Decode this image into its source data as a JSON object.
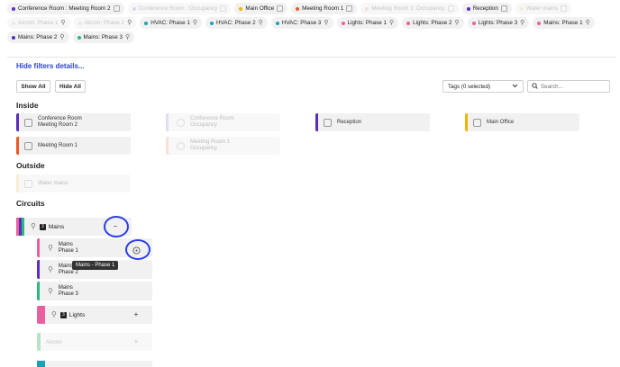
{
  "chips": [
    {
      "label": "Conference Room : Meeting Room 2",
      "color": "#5b2dbd",
      "faded": false,
      "icon": "square"
    },
    {
      "label": "Conference Room : Occupancy",
      "color": "#b9a6e6",
      "faded": true,
      "icon": "square"
    },
    {
      "label": "Main Office",
      "color": "#f0b400",
      "faded": false,
      "icon": "square"
    },
    {
      "label": "Meeting Room 1",
      "color": "#ee5a24",
      "faded": false,
      "icon": "square"
    },
    {
      "label": "Meeting Room 1: Occupancy",
      "color": "#f6b89f",
      "faded": true,
      "icon": "square"
    },
    {
      "label": "Reception",
      "color": "#5b2dbd",
      "faded": false,
      "icon": "square"
    },
    {
      "label": "Water mains",
      "color": "#f8d98b",
      "faded": true,
      "icon": "square"
    },
    {
      "label": "Aircon: Phase 1",
      "color": "#b7e4c7",
      "faded": true,
      "icon": "bulb"
    },
    {
      "label": "Aircon: Phase 2",
      "color": "#b7e4c7",
      "faded": true,
      "icon": "bulb"
    },
    {
      "label": "HVAC: Phase 1",
      "color": "#1aa3b8",
      "faded": false,
      "icon": "bulb"
    },
    {
      "label": "HVAC: Phase 2",
      "color": "#1aa3b8",
      "faded": false,
      "icon": "bulb"
    },
    {
      "label": "HVAC: Phase 3",
      "color": "#1aa3b8",
      "faded": false,
      "icon": "bulb"
    },
    {
      "label": "Lights: Phase 1",
      "color": "#ea5f9e",
      "faded": false,
      "icon": "bulb"
    },
    {
      "label": "Lights: Phase 2",
      "color": "#ea5f9e",
      "faded": false,
      "icon": "bulb"
    },
    {
      "label": "Lights: Phase 3",
      "color": "#ea5f9e",
      "faded": false,
      "icon": "bulb"
    },
    {
      "label": "Mains: Phase 1",
      "color": "#ea5f9e",
      "faded": false,
      "icon": "bulb"
    },
    {
      "label": "Mains: Phase 2",
      "color": "#5b2dbd",
      "faded": false,
      "icon": "bulb"
    },
    {
      "label": "Mains: Phase 3",
      "color": "#2ab880",
      "faded": false,
      "icon": "bulb"
    }
  ],
  "filters": {
    "hide_link": "Hide filters details...",
    "show_all": "Show All",
    "hide_all": "Hide All",
    "tags_select": "Tags (0 selected)",
    "search_placeholder": "Search..."
  },
  "sections": {
    "inside": "Inside",
    "outside": "Outside",
    "circuits": "Circuits"
  },
  "inside_cards": [
    {
      "line1": "Conference Room",
      "line2": "Meeting Room 2",
      "color": "#5b2dbd",
      "faded": false
    },
    {
      "line1": "Conference Room",
      "line2": "Occupancy",
      "color": "#b9a6e6",
      "faded": true
    },
    {
      "line1": "Reception",
      "line2": "",
      "color": "#5b2dbd",
      "faded": false
    },
    {
      "line1": "Main Office",
      "line2": "",
      "color": "#f0b400",
      "faded": false
    },
    {
      "line1": "Meeting Room 1",
      "line2": "",
      "color": "#ee5a24",
      "faded": false
    },
    {
      "line1": "Meeting Room 1",
      "line2": "Occupancy",
      "color": "#f6b89f",
      "faded": true
    }
  ],
  "outside_cards": [
    {
      "line1": "Water mains",
      "line2": "",
      "color": "#f8d98b",
      "faded": true
    }
  ],
  "circuits": {
    "mains": {
      "label": "Mains",
      "count": "3",
      "toggle": "−",
      "colors": [
        "#ea5f9e",
        "#5b2dbd",
        "#2ab880"
      ]
    },
    "phases": [
      {
        "line1": "Mains",
        "line2": "Phase 1",
        "color": "#ea5f9e"
      },
      {
        "line1": "Mains",
        "line2": "Phase 2",
        "color": "#5b2dbd"
      },
      {
        "line1": "Mains",
        "line2": "Phase 3",
        "color": "#2ab880"
      }
    ],
    "lights": {
      "label": "Lights",
      "count": "3",
      "toggle": "+",
      "color": "#ea5f9e"
    },
    "aircon": {
      "label": "Aircon",
      "toggle": "+",
      "color": "#b7e4c7"
    },
    "hvac_color": "#1aa3b8"
  },
  "tooltip": "Mains - Phase 1"
}
